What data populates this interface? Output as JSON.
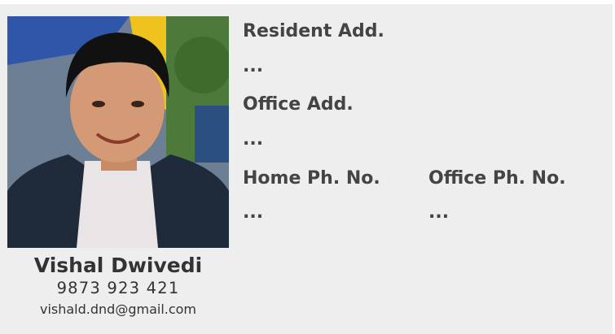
{
  "profile": {
    "name": "Vishal Dwivedi",
    "phone": "9873 923 421",
    "email": "vishald.dnd@gmail.com",
    "photo_icon": "person-portrait"
  },
  "fields": {
    "resident_address": {
      "label": "Resident Add.",
      "value": "..."
    },
    "office_address": {
      "label": "Office Add.",
      "value": "..."
    },
    "home_phone": {
      "label": "Home Ph. No.",
      "value": "..."
    },
    "office_phone": {
      "label": "Office Ph. No.",
      "value": "..."
    }
  },
  "colors": {
    "panel_background": "#eeeeee",
    "text": "#444444"
  }
}
